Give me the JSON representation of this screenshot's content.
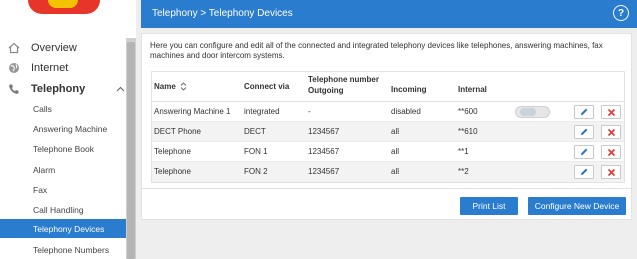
{
  "header": {
    "breadcrumb": "Telephony > Telephony Devices",
    "help": "?"
  },
  "sidebar": {
    "overview": "Overview",
    "internet": "Internet",
    "telephony": "Telephony",
    "subitems": [
      "Calls",
      "Answering Machine",
      "Telephone Book",
      "Alarm",
      "Fax",
      "Call Handling",
      "Telephony Devices",
      "Telephone Numbers"
    ],
    "active": "Telephony Devices"
  },
  "main": {
    "intro": "Here you can configure and edit all of the connected and integrated telephony devices like telephones, answering machines, fax machines and door intercom systems.",
    "headers": {
      "name": "Name",
      "connect": "Connect via",
      "number_top": "Telephone number",
      "outgoing": "Outgoing",
      "incoming": "Incoming",
      "internal": "Internal"
    },
    "rows": [
      {
        "name": "Answering Machine 1",
        "connect": "integrated",
        "outgoing": "-",
        "incoming": "disabled",
        "internal": "**600"
      },
      {
        "name": "DECT Phone",
        "connect": "DECT",
        "outgoing": "1234567",
        "incoming": "all",
        "internal": "**610"
      },
      {
        "name": "Telephone",
        "connect": "FON 1",
        "outgoing": "1234567",
        "incoming": "all",
        "internal": "**1"
      },
      {
        "name": "Telephone",
        "connect": "FON 2",
        "outgoing": "1234567",
        "incoming": "all",
        "internal": "**2"
      }
    ],
    "buttons": {
      "print": "Print List",
      "configure": "Configure New Device"
    }
  },
  "colors": {
    "accent": "#2a7ccf",
    "delete": "#e53935"
  },
  "icons": [
    "home-icon",
    "globe-icon",
    "phone-icon",
    "chevron-up-icon",
    "sort-icon",
    "pencil-icon",
    "close-icon",
    "help-icon"
  ]
}
